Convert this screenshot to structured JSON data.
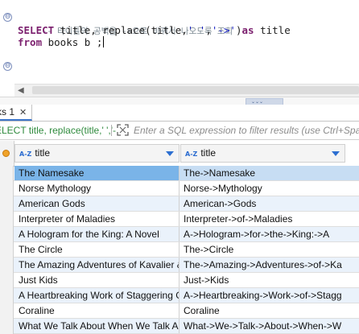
{
  "editor": {
    "comment": "-- 타이틀의 공백을 ->으로 바꿔서 나오도록 조회",
    "line2": {
      "kw_select": "SELECT",
      "t1": " title, ",
      "fn": "replace",
      "t2": "(title,",
      "s1": "' '",
      "t3": ",",
      "s2": "'->'",
      "t4": ")",
      "kw_as": "as",
      "t5": " title"
    },
    "line3": {
      "kw_from": "from",
      "t1": " books b ;"
    },
    "fold_glyph": "⊖"
  },
  "results": {
    "tab_label": "ks 1",
    "tab_close": "✕",
    "filter_query": "ELECT title, replace(title,' ','-",
    "filter_placeholder": "Enter a SQL expression to filter results (use Ctrl+Spa",
    "columns": [
      {
        "type_badge": "A-Z",
        "label": "title"
      },
      {
        "type_badge": "A-Z",
        "label": "title"
      }
    ],
    "rows": [
      {
        "c1": "The Namesake",
        "c2": "The->Namesake"
      },
      {
        "c1": "Norse Mythology",
        "c2": "Norse->Mythology"
      },
      {
        "c1": "American Gods",
        "c2": "American->Gods"
      },
      {
        "c1": "Interpreter of Maladies",
        "c2": "Interpreter->of->Maladies"
      },
      {
        "c1": "A Hologram for the King: A Novel",
        "c2": "A->Hologram->for->the->King:->A"
      },
      {
        "c1": "The Circle",
        "c2": "The->Circle"
      },
      {
        "c1": "The Amazing Adventures of Kavalier &",
        "c2": "The->Amazing->Adventures->of->Ka"
      },
      {
        "c1": "Just Kids",
        "c2": "Just->Kids"
      },
      {
        "c1": "A Heartbreaking Work of Staggering G",
        "c2": "A->Heartbreaking->Work->of->Stagg"
      },
      {
        "c1": "Coraline",
        "c2": "Coraline"
      },
      {
        "c1": "What We Talk About When We Talk Ab",
        "c2": "What->We->Talk->About->When->W"
      }
    ]
  },
  "colors": {
    "keyword": "#7b1f6e",
    "string": "#1a23c4",
    "comment": "#7f8c95",
    "selected_cell": "#7ab4e8",
    "selected_row": "#c7ddf3",
    "alt_row": "#eaf2fb",
    "filter_text": "#2e8a3c"
  }
}
